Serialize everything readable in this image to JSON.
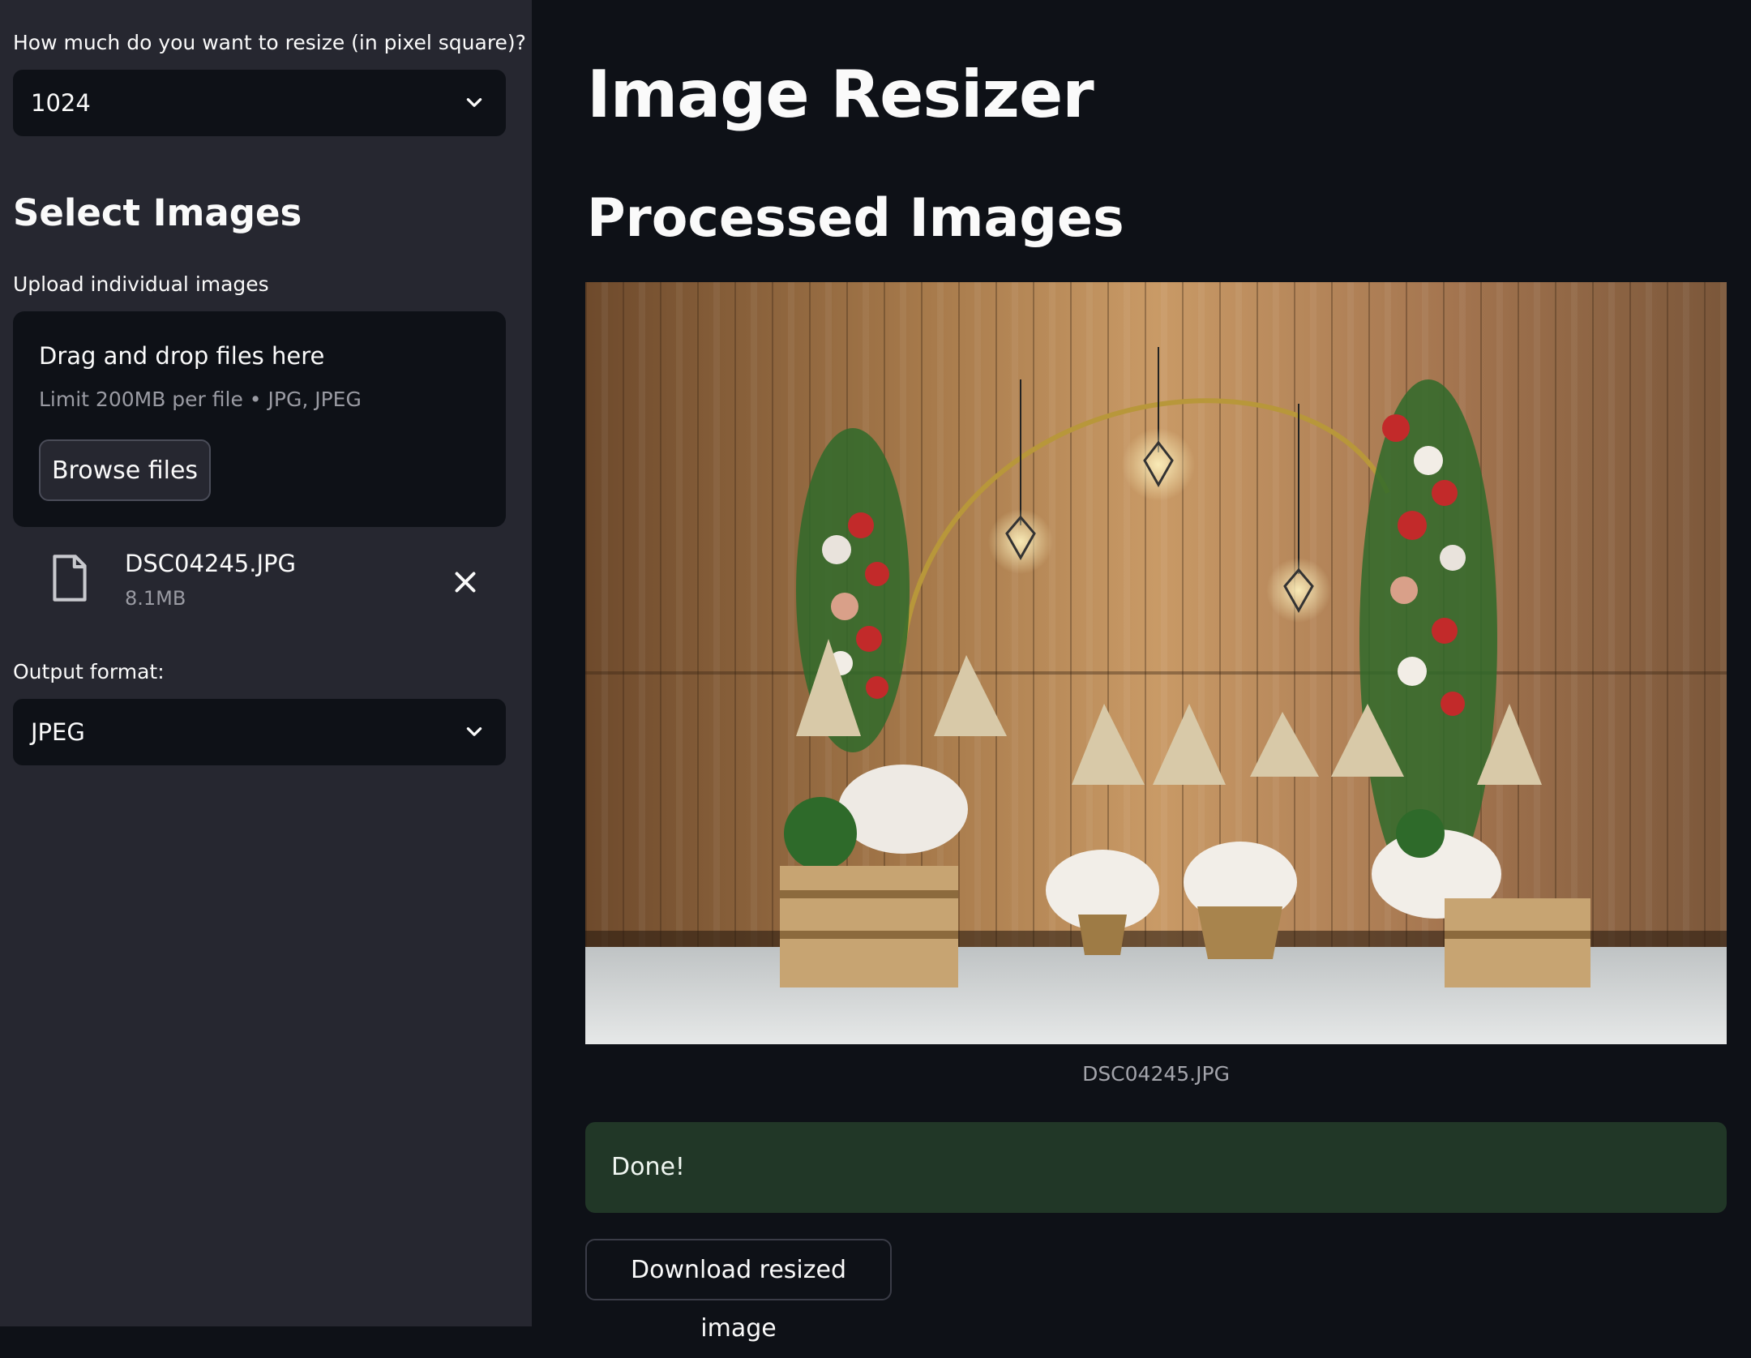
{
  "sidebar": {
    "resize_label": "How much do you want to resize (in pixel square)?",
    "resize_value": "1024",
    "section_title": "Select Images",
    "upload_label": "Upload individual images",
    "dropzone": {
      "title": "Drag and drop files here",
      "limit": "Limit 200MB per file • JPG, JPEG",
      "browse_label": "Browse files"
    },
    "uploaded_file": {
      "name": "DSC04245.JPG",
      "size": "8.1MB"
    },
    "format_label": "Output format:",
    "format_value": "JPEG"
  },
  "main": {
    "title": "Image Resizer",
    "subtitle": "Processed Images",
    "image_caption": "DSC04245.JPG",
    "success_message": "Done!",
    "download_label": "Download resized image"
  },
  "icons": {
    "dropdown": "chevron-down-icon",
    "file": "file-icon",
    "remove": "close-icon"
  },
  "colors": {
    "sidebar_bg": "#262730",
    "main_bg": "#0e1117",
    "success_bg": "#213727"
  }
}
